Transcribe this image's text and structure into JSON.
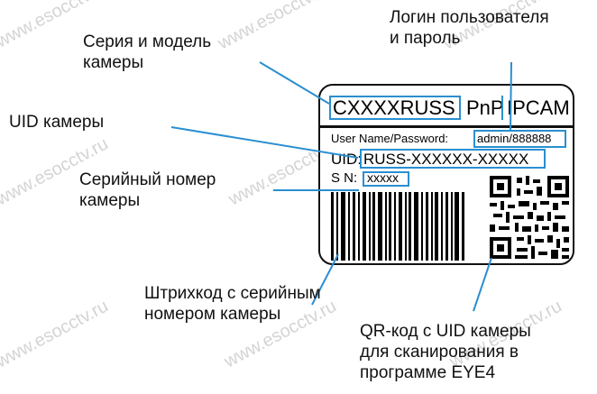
{
  "watermark": "www.esocctv.ru",
  "callouts": {
    "model": [
      "Серия и модель",
      "камеры"
    ],
    "login": [
      "Логин пользователя",
      "и пароль"
    ],
    "uid": [
      "UID камеры"
    ],
    "serial": [
      "Серийный номер",
      "камеры"
    ],
    "barcode": [
      "Штрихкод с серийным",
      "номером камеры"
    ],
    "qr": [
      "QR-код с UID камеры",
      "для сканирования в",
      "программе EYE4"
    ]
  },
  "label": {
    "model": "CXXXXRUSS",
    "pnp": "PnP",
    "ipcam": "IPCAM",
    "userpass_label": "User Name/Password:",
    "userpass_value": "admin/888888",
    "uid_label": "UID:",
    "uid_value": "RUSS-XXXXXX-XXXXX",
    "sn_label": "S N:",
    "sn_value": "xxxxx"
  },
  "colors": {
    "highlight_box": "#2a8fd0",
    "leader_line": "#2a8fd0",
    "watermark": "#d4d4d4"
  }
}
